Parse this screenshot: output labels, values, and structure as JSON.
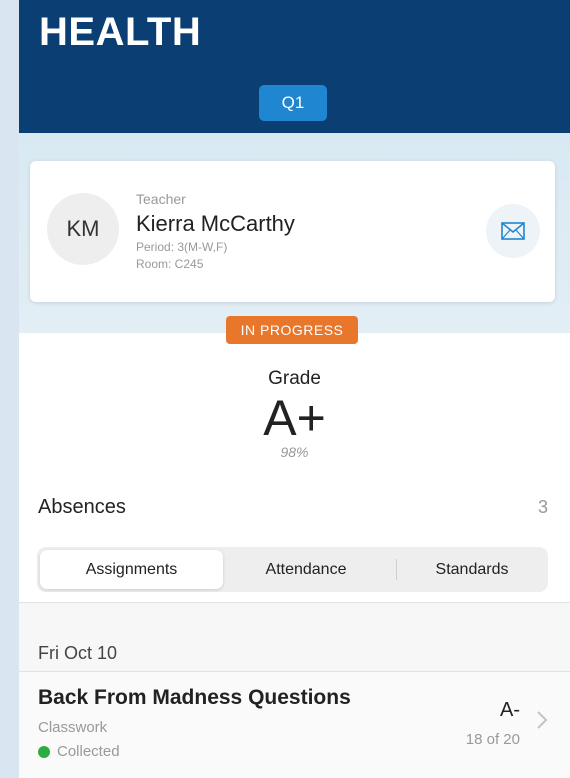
{
  "header": {
    "title": "HEALTH",
    "term": "Q1"
  },
  "teacher": {
    "initials": "KM",
    "label": "Teacher",
    "name": "Kierra McCarthy",
    "period": "Period: 3(M-W,F)",
    "room": "Room: C245",
    "mail_icon": "envelope-icon"
  },
  "status": {
    "label": "IN PROGRESS",
    "color": "#e8772c"
  },
  "grade": {
    "label": "Grade",
    "letter": "A+",
    "percent": "98%"
  },
  "absences": {
    "label": "Absences",
    "count": "3"
  },
  "tabs": [
    {
      "label": "Assignments",
      "active": true
    },
    {
      "label": "Attendance",
      "active": false
    },
    {
      "label": "Standards",
      "active": false
    }
  ],
  "assignments": {
    "date": "Fri Oct 10",
    "items": [
      {
        "title": "Back From Madness Questions",
        "category": "Classwork",
        "status": "Collected",
        "status_color": "#2eac44",
        "grade": "A-",
        "score": "18 of 20"
      }
    ]
  },
  "colors": {
    "header_bg": "#0b3f73",
    "accent": "#1f86d1"
  }
}
